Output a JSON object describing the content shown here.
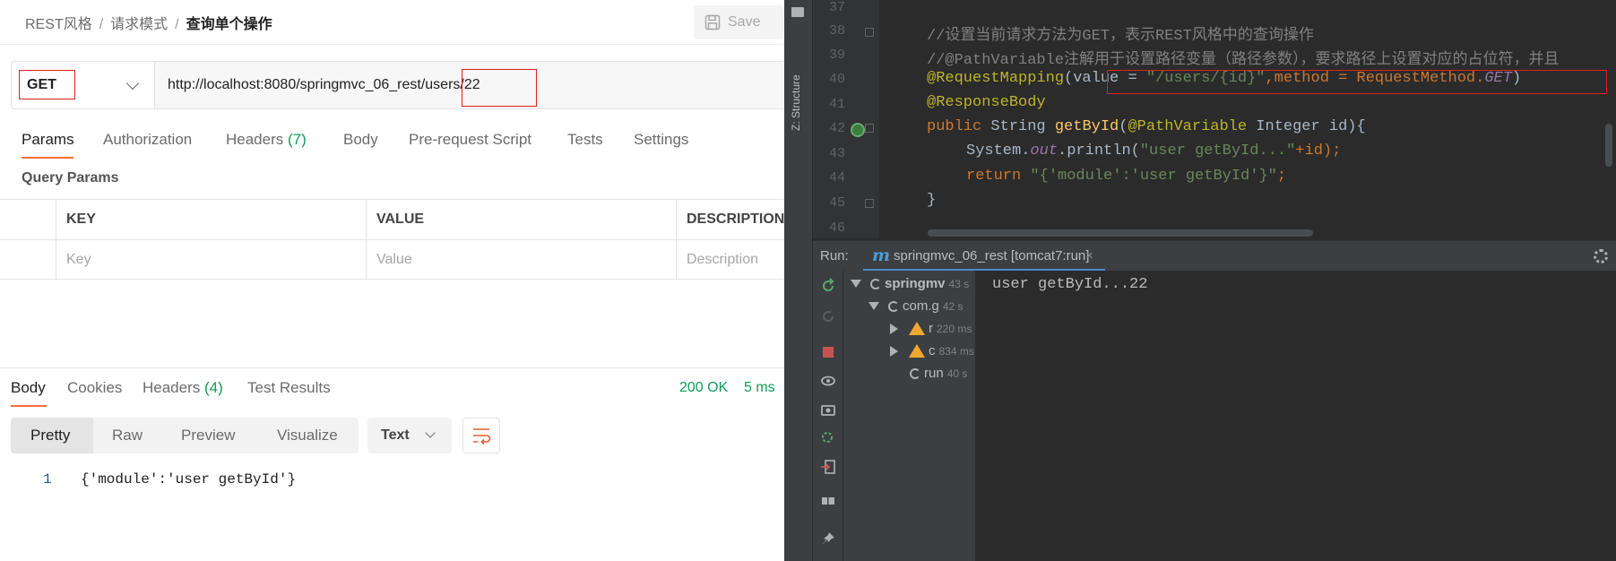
{
  "postman": {
    "breadcrumb": {
      "collection": "REST风格",
      "folder": "请求模式",
      "request": "查询单个操作"
    },
    "save_label": "Save",
    "method": "GET",
    "url": "http://localhost:8080/springmvc_06_rest/users/22",
    "request_tabs": {
      "params": "Params",
      "authorization": "Authorization",
      "headers": "Headers",
      "headers_count": "(7)",
      "body": "Body",
      "prerequest": "Pre-request Script",
      "tests": "Tests",
      "settings": "Settings"
    },
    "query_params": {
      "label": "Query Params",
      "columns": [
        "KEY",
        "VALUE",
        "DESCRIPTION"
      ],
      "placeholders": [
        "Key",
        "Value",
        "Description"
      ]
    },
    "response_tabs": {
      "body": "Body",
      "cookies": "Cookies",
      "headers": "Headers",
      "headers_count": "(4)",
      "test_results": "Test Results"
    },
    "status": "200 OK",
    "time": "5 ms",
    "format_buttons": [
      "Pretty",
      "Raw",
      "Preview",
      "Visualize"
    ],
    "format_type": "Text",
    "response_body": {
      "line_number": "1",
      "content": "{'module':'user getById'}"
    }
  },
  "ide": {
    "structure_tab": "Z: Structure",
    "line_numbers": [
      "37",
      "38",
      "39",
      "40",
      "41",
      "42",
      "43",
      "44",
      "45",
      "46"
    ],
    "code": {
      "l38": "//设置当前请求方法为GET，表示REST风格中的查询操作",
      "l39": "//@PathVariable注解用于设置路径变量（路径参数），要求路径上设置对应的占位符，并且",
      "l40_ann": "@RequestMapping",
      "l40_open": "(",
      "l40_value_kw": "value = ",
      "l40_str": "\"/users/{id}\"",
      "l40_method": ",method = RequestMethod.",
      "l40_get": "GET",
      "l40_close": ")",
      "l41": "@ResponseBody",
      "l42_kw": "public ",
      "l42_type": "String ",
      "l42_fn": "getById",
      "l42_paren": "(",
      "l42_ann": "@PathVariable",
      "l42_rest": " Integer id){",
      "l43_a": "System.",
      "l43_out": "out",
      "l43_b": ".println(",
      "l43_str": "\"user getById...\"",
      "l43_c": "+id);",
      "l44_kw": "return ",
      "l44_str": "\"{'module':'user getById'}\"",
      "l44_end": ";",
      "l45": "}"
    },
    "run": {
      "label": "Run:",
      "tab_title": "springmvc_06_rest [tomcat7:run]",
      "tree": [
        {
          "label": "springmv",
          "time": "43 s"
        },
        {
          "label": "com.g",
          "time": "42 s"
        },
        {
          "label": "r",
          "time": "220 ms"
        },
        {
          "label": "c",
          "time": "834 ms"
        },
        {
          "label": "run",
          "time": "40 s"
        }
      ],
      "console_output": "user getById...22"
    }
  }
}
